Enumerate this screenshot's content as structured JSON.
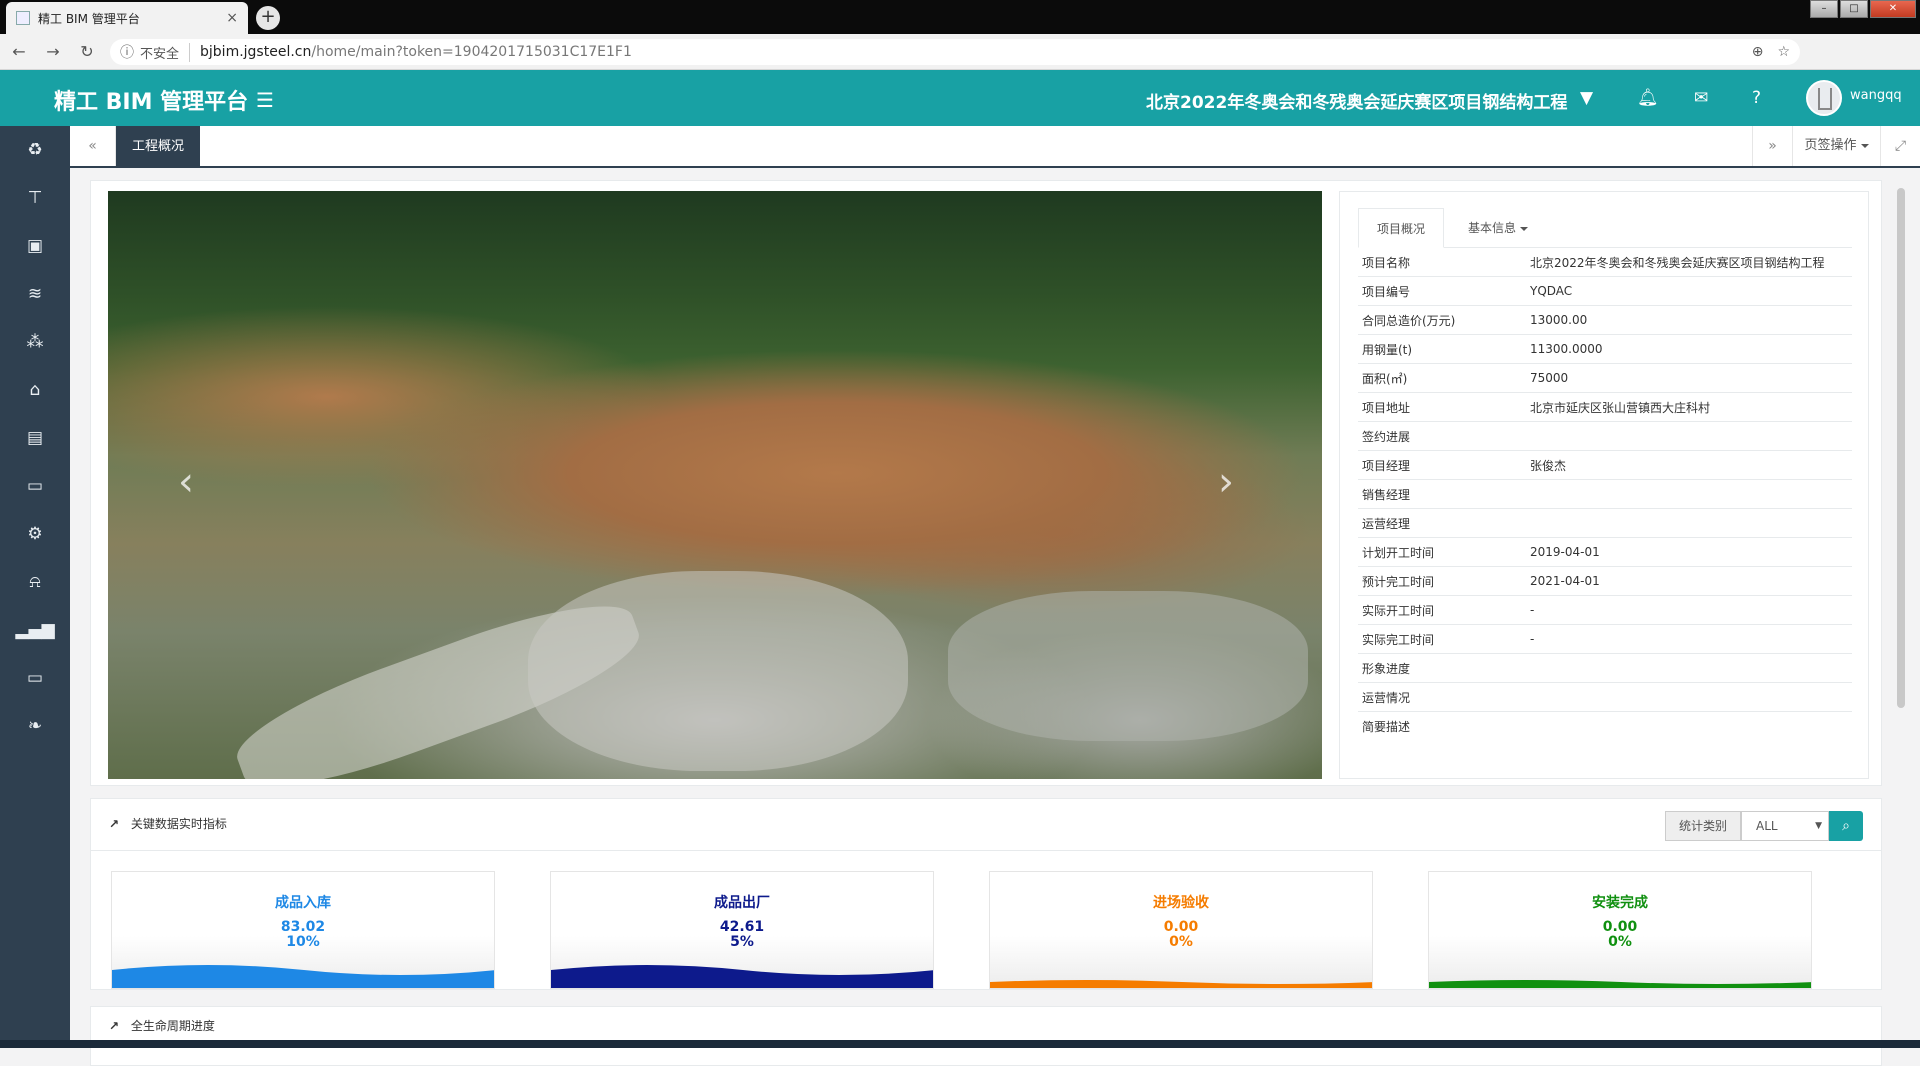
{
  "browser": {
    "tab_title": "精工 BIM 管理平台",
    "close_glyph": "×",
    "new_tab_glyph": "+",
    "insecure_label": "不安全",
    "url_host": "bjbim.jgsteel.cn",
    "url_path": "/home/main?token=1904201715031C17E1F1",
    "icons": [
      "back-icon",
      "forward-icon",
      "reload-icon",
      "info-icon",
      "zoom-icon",
      "star-icon",
      "profile-icon",
      "menu-icon"
    ]
  },
  "header": {
    "brand": "精工 BIM 管理平台",
    "project_title": "北京2022年冬奥会和冬残奥会延庆赛区项目钢结构工程",
    "username": "wangqq",
    "accent_color": "#18a1a4"
  },
  "sidebar": {
    "color": "#2f4050",
    "icons": [
      "recycle-icon",
      "sign-icon",
      "briefcase-icon",
      "database-icon",
      "cubes-icon",
      "bank-icon",
      "building-icon",
      "money-icon",
      "cogs-icon",
      "bell-icon",
      "signal-icon",
      "desktop-icon",
      "leaf-icon"
    ]
  },
  "page_tabs": {
    "active": "工程概况",
    "ops_label": "页签操作"
  },
  "overview": {
    "tabs": [
      "项目概况",
      "基本信息"
    ],
    "rows": [
      {
        "k": "项目名称",
        "v": "北京2022年冬奥会和冬残奥会延庆赛区项目钢结构工程"
      },
      {
        "k": "项目编号",
        "v": "YQDAC"
      },
      {
        "k": "合同总造价(万元)",
        "v": "13000.00"
      },
      {
        "k": "用钢量(t)",
        "v": "11300.0000"
      },
      {
        "k": "面积(㎡)",
        "v": "75000"
      },
      {
        "k": "项目地址",
        "v": "北京市延庆区张山营镇西大庄科村"
      },
      {
        "k": "签约进展",
        "v": ""
      },
      {
        "k": "项目经理",
        "v": "张俊杰"
      },
      {
        "k": "销售经理",
        "v": ""
      },
      {
        "k": "运营经理",
        "v": ""
      },
      {
        "k": "计划开工时间",
        "v": "2019-04-01"
      },
      {
        "k": "预计完工时间",
        "v": "2021-04-01"
      },
      {
        "k": "实际开工时间",
        "v": "-"
      },
      {
        "k": "实际完工时间",
        "v": "-"
      },
      {
        "k": "形象进度",
        "v": ""
      },
      {
        "k": "运营情况",
        "v": ""
      },
      {
        "k": "简要描述",
        "v": ""
      }
    ]
  },
  "kpi": {
    "title": "关键数据实时指标",
    "stat_label": "统计类别",
    "stat_value": "ALL",
    "cards": [
      {
        "title": "成品入库",
        "value": "83.02",
        "percent": "10%",
        "color": "#1e88e5"
      },
      {
        "title": "成品出厂",
        "value": "42.61",
        "percent": "5%",
        "color": "#0d1a8c"
      },
      {
        "title": "进场验收",
        "value": "0.00",
        "percent": "0%",
        "color": "#f57c00"
      },
      {
        "title": "安装完成",
        "value": "0.00",
        "percent": "0%",
        "color": "#109010"
      }
    ]
  },
  "lifecycle": {
    "title": "全生命周期进度"
  }
}
